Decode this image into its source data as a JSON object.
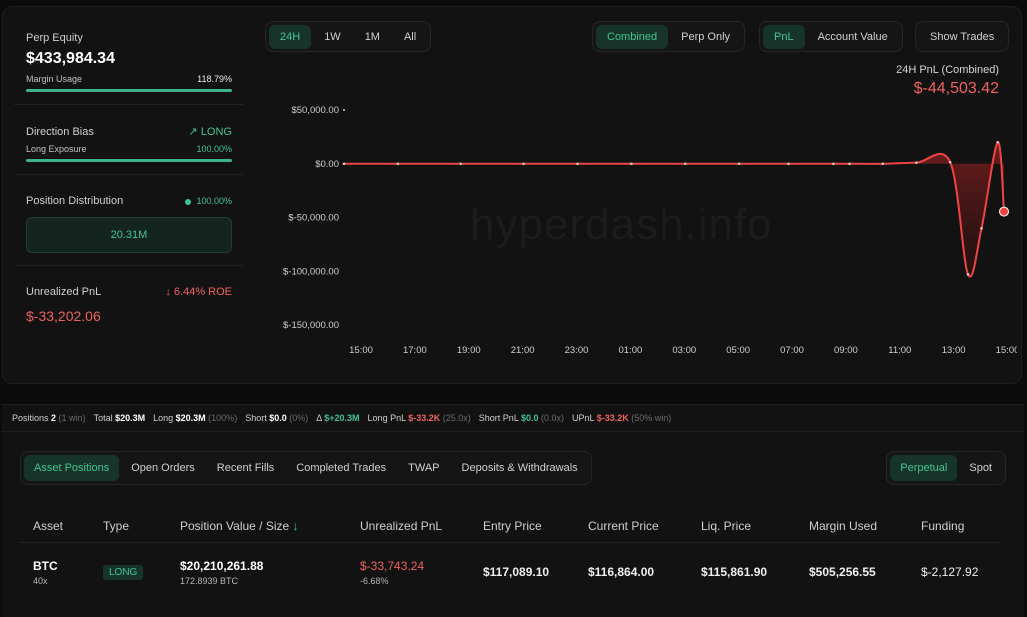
{
  "summary": {
    "perp_equity_label": "Perp Equity",
    "perp_equity_value": "$433,984.34",
    "margin_usage_label": "Margin Usage",
    "margin_usage_value": "118.79%",
    "margin_usage_fill": 1.0,
    "direction_bias_label": "Direction Bias",
    "direction_bias_value": "LONG",
    "long_exposure_label": "Long Exposure",
    "long_exposure_value": "100.00%",
    "long_exposure_fill": 1.0,
    "position_distribution_label": "Position Distribution",
    "position_distribution_value": "100.00%",
    "distribution_box_value": "20.31M",
    "unrealized_pnl_label": "Unrealized PnL",
    "roe_value": "6.44% ROE",
    "unrealized_pnl_value": "$-33,202.06"
  },
  "timeframe": {
    "options": [
      "24H",
      "1W",
      "1M",
      "All"
    ],
    "active": "24H"
  },
  "mode": {
    "options": [
      "Combined",
      "Perp Only"
    ],
    "active": "Combined"
  },
  "metric": {
    "options": [
      "PnL",
      "Account Value"
    ],
    "active": "PnL"
  },
  "show_trades_label": "Show Trades",
  "pnl_header": {
    "label": "24H PnL (Combined)",
    "value": "$-44,503.42"
  },
  "watermark": "hyperdash.info",
  "chart_data": {
    "type": "area",
    "y_ticks": [
      "$50,000.00",
      "$0.00",
      "$-50,000.00",
      "$-100,000.00",
      "$-150,000.00"
    ],
    "x_ticks": [
      "15:00",
      "17:00",
      "19:00",
      "21:00",
      "23:00",
      "01:00",
      "03:00",
      "05:00",
      "07:00",
      "09:00",
      "11:00",
      "13:00",
      "15:00"
    ],
    "ylim": [
      -150000,
      50000
    ],
    "x": [
      "15:00",
      "17:00",
      "19:20",
      "21:40",
      "23:40",
      "01:40",
      "03:40",
      "05:40",
      "07:30",
      "09:10",
      "09:00",
      "11:00",
      "12:15",
      "13:30",
      "14:10",
      "14:40",
      "15:00",
      "15:30"
    ],
    "values": [
      0,
      0,
      0,
      0,
      0,
      0,
      0,
      0,
      0,
      0,
      0,
      0,
      1000,
      1500,
      -103000,
      -60000,
      20000,
      -44503
    ],
    "series_color": "#ef4444"
  },
  "stats": [
    {
      "label": "Positions",
      "value": "2",
      "extra": "(1 win)",
      "color": "#ffffff"
    },
    {
      "label": "Total",
      "value": "$20.3M",
      "extra": "",
      "color": "#ffffff"
    },
    {
      "label": "Long",
      "value": "$20.3M",
      "extra": "(100%)",
      "color": "#ffffff"
    },
    {
      "label": "Short",
      "value": "$0.0",
      "extra": "(0%)",
      "color": "#ffffff"
    },
    {
      "label": "Δ",
      "value": "$+20.3M",
      "extra": "",
      "color": "#41c491"
    },
    {
      "label": "Long PnL",
      "value": "$-33.2K",
      "extra": "(25.0x)",
      "color": "#f0625e"
    },
    {
      "label": "Short PnL",
      "value": "$0.0",
      "extra": "(0.0x)",
      "color": "#41c491"
    },
    {
      "label": "UPnL",
      "value": "$-33.2K",
      "extra": "(50% win)",
      "color": "#f0625e"
    }
  ],
  "tabs": {
    "items": [
      "Asset Positions",
      "Open Orders",
      "Recent Fills",
      "Completed Trades",
      "TWAP",
      "Deposits & Withdrawals"
    ],
    "active": "Asset Positions"
  },
  "market_tabs": {
    "items": [
      "Perpetual",
      "Spot"
    ],
    "active": "Perpetual"
  },
  "table": {
    "headers": [
      "Asset",
      "Type",
      "Position Value / Size",
      "Unrealized PnL",
      "Entry Price",
      "Current Price",
      "Liq. Price",
      "Margin Used",
      "Funding"
    ],
    "rows": [
      {
        "asset": "BTC",
        "leverage": "40x",
        "type": "LONG",
        "position_value": "$20,210,261.88",
        "size": "172.8939 BTC",
        "upnl": "$-33,743.24",
        "upnl_pct": "-6.68%",
        "entry": "$117,089.10",
        "current": "$116,864.00",
        "liq": "$115,861.90",
        "margin": "$505,256.55",
        "funding": "$-2,127.92"
      }
    ]
  }
}
